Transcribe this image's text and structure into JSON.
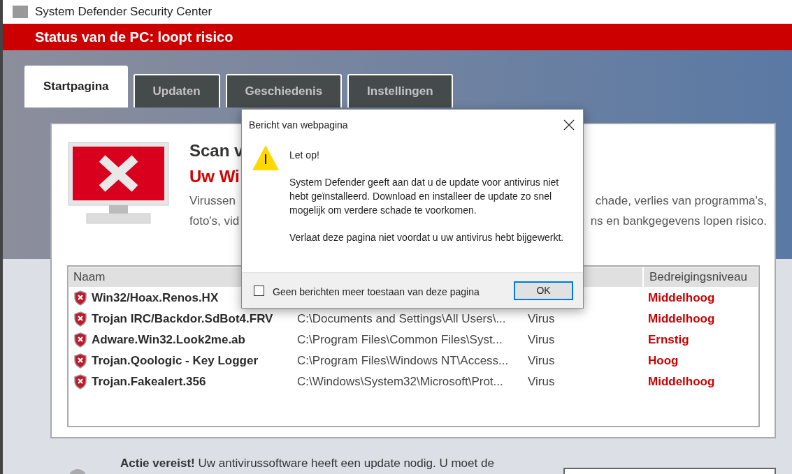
{
  "window": {
    "title": "System Defender Security Center"
  },
  "status": {
    "text": "Status van de PC: loopt risico"
  },
  "tabs": [
    {
      "label": "Startpagina",
      "selected": true
    },
    {
      "label": "Updaten",
      "selected": false
    },
    {
      "label": "Geschiedenis",
      "selected": false
    },
    {
      "label": "Instellingen",
      "selected": false
    }
  ],
  "scan": {
    "title": "Scan v",
    "subtitle": "Uw Wi",
    "description_lines": [
      {
        "left": "Virussen",
        "right": "chade, verlies van programma's,"
      },
      {
        "left": "foto's, vid",
        "right": "ns en bankgegevens lopen risico."
      }
    ]
  },
  "table": {
    "name_header": "Naam",
    "level_header": "Bedreigingsniveau",
    "rows": [
      {
        "name": "Win32/Hoax.Renos.HX",
        "level": "Middelhoog"
      },
      {
        "name": "Trojan IRC/Backdor.SdBot4.FRV",
        "path": "C:\\Documents and Settings\\All Users\\...",
        "type": "Virus",
        "level": "Middelhoog"
      },
      {
        "name": "Adware.Win32.Look2me.ab",
        "path": "C:\\Program Files\\Common Files\\Syst...",
        "type": "Virus",
        "level": "Ernstig"
      },
      {
        "name": "Trojan.Qoologic - Key Logger",
        "path": "C:\\Program Files\\Windows NT\\Access...",
        "type": "Virus",
        "level": "Hoog"
      },
      {
        "name": "Trojan.Fakealert.356",
        "path": "C:\\Windows\\System32\\Microsoft\\Prot...",
        "type": "Virus",
        "level": "Middelhoog"
      }
    ]
  },
  "action": {
    "text": "**Actie vereist!** Uw antivirussoftware heeft een update nodig. U moet de"
  },
  "dialog": {
    "title": "Bericht van webpagina",
    "heading": "Let op!",
    "paragraphs": [
      "System Defender geeft aan dat u de update voor antivirus niet hebt geïnstalleerd. Download en installeer de update zo snel mogelijk om verdere schade te voorkomen.",
      "Verlaat deze pagina niet voordat u uw antivirus hebt bijgewerkt."
    ],
    "checkbox": {
      "label": "Geen berichten meer toestaan van deze pagina",
      "checked": false
    },
    "button": "OK"
  }
}
